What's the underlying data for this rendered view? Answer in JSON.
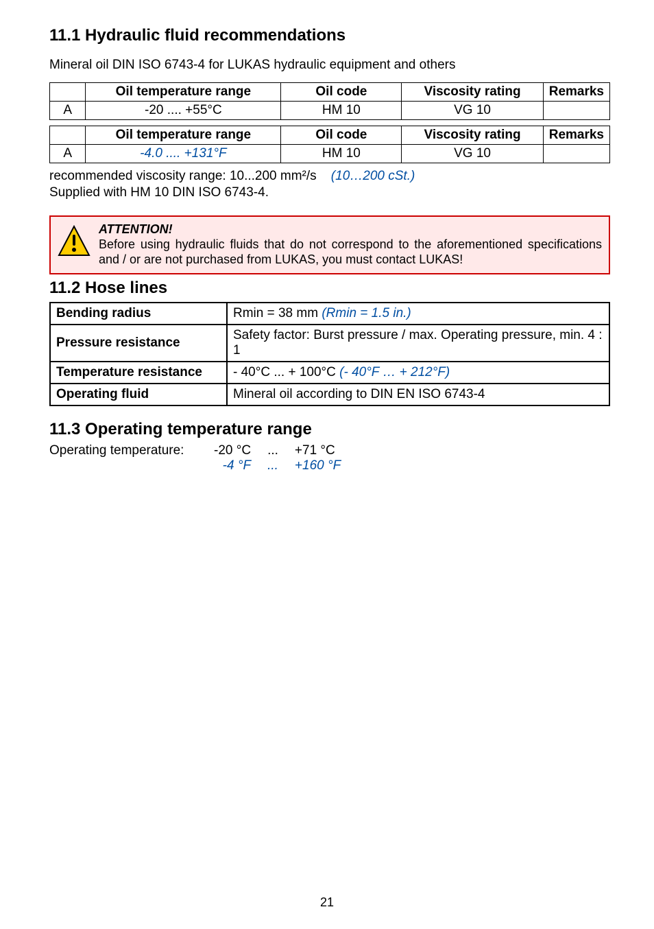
{
  "section_11_1_title": "11.1  Hydraulic fluid recommendations",
  "intro": "Mineral oil DIN ISO 6743-4 for LUKAS hydraulic equipment and others",
  "table_oil_c": {
    "headers": [
      "",
      "Oil temperature range",
      "Oil code",
      "Viscosity rating",
      "Remarks"
    ],
    "rows": [
      {
        "key": "A",
        "range": "-20 .... +55°C",
        "code": "HM 10",
        "visc": "VG 10",
        "remarks": ""
      }
    ]
  },
  "table_oil_f": {
    "headers": [
      "",
      "Oil temperature range",
      "Oil code",
      "Viscosity rating",
      "Remarks"
    ],
    "rows": [
      {
        "key": "A",
        "range": "-4.0 .... +131°F",
        "code": "HM 10",
        "visc": "VG 10",
        "remarks": ""
      }
    ]
  },
  "visc_line_a": "recommended viscosity range: 10...200 mm²/s",
  "visc_line_b": "(10…200 cSt.)",
  "supplied_line": "Supplied with HM 10 DIN ISO 6743-4.",
  "attention_title": "ATTENTION!",
  "attention_body": "Before using hydraulic fluids that do not correspond to the aforementioned specifications and / or are not purchased from LUKAS, you must contact LUKAS!",
  "section_11_2_title": "11.2  Hose lines",
  "hose": {
    "bending_label": "Bending radius",
    "bending_value_a": "Rmin = 38 mm  ",
    "bending_value_b": "(Rmin = 1.5 in.)",
    "pressure_label": "Pressure resistance",
    "pressure_value": "Safety factor: Burst pressure / max. Operating pressure, min. 4 : 1",
    "temp_label": "Temperature resistance",
    "temp_value_a": "- 40°C ... + 100°C   ",
    "temp_value_b": "(- 40°F … + 212°F)",
    "fluid_label": "Operating fluid",
    "fluid_value": "Mineral oil according to DIN EN ISO 6743-4"
  },
  "section_11_3_title": "11.3  Operating temperature range",
  "optemp_label": "Operating temperature:",
  "optemp_c_lo": "-20 °C",
  "optemp_c_dots": "...",
  "optemp_c_hi": "+71 °C",
  "optemp_f_lo": "-4 °F",
  "optemp_f_dots": "...",
  "optemp_f_hi": "+160 °F",
  "page_number": "21"
}
